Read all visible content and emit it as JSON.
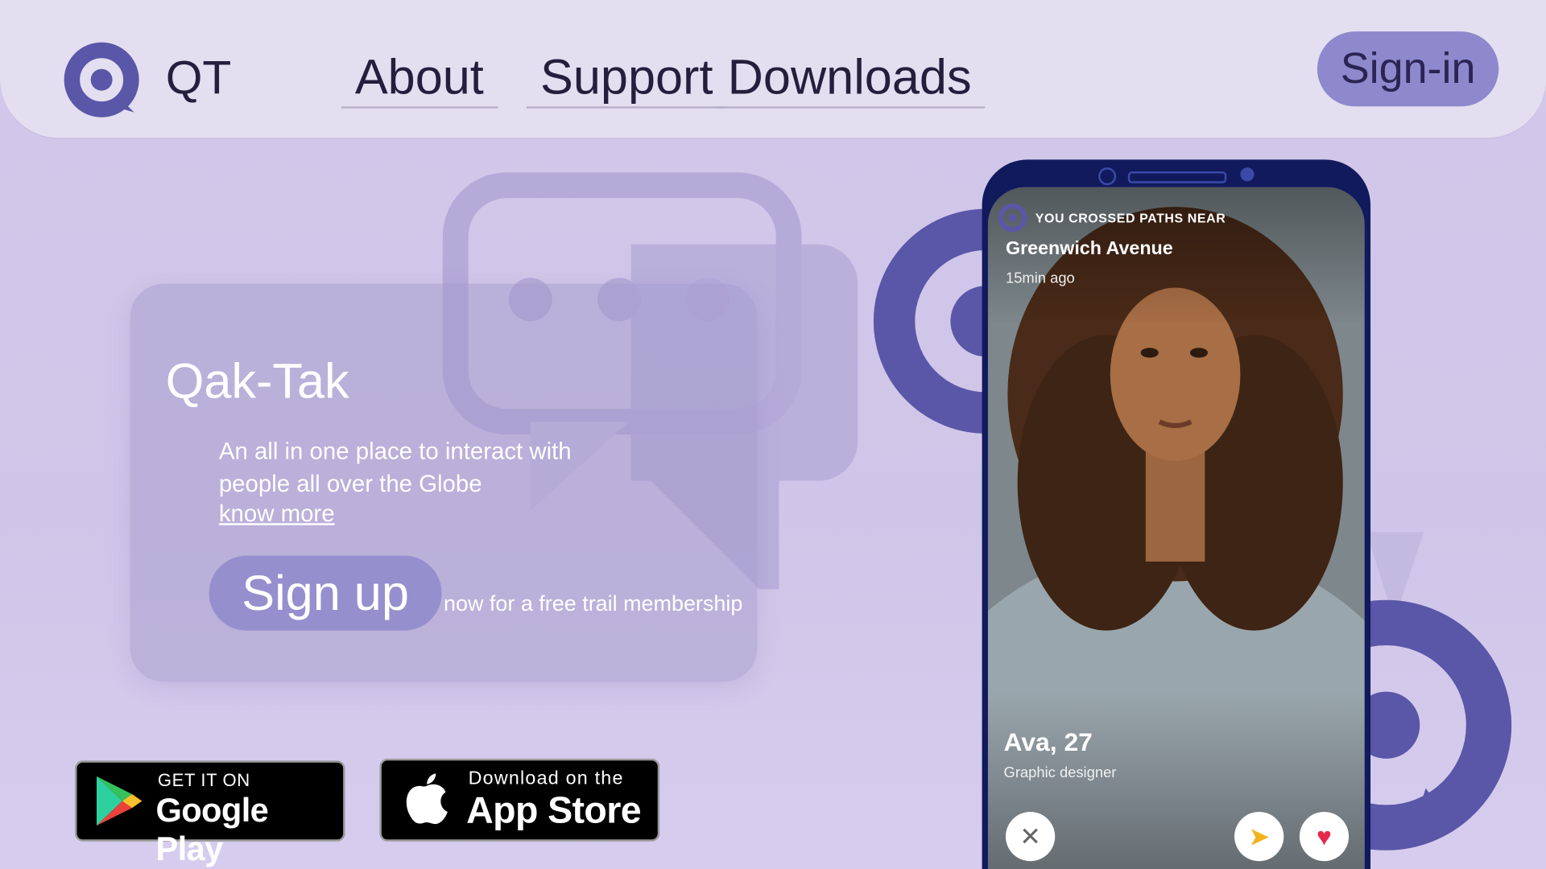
{
  "header": {
    "brand": "QT",
    "nav": {
      "about": "About",
      "support": "Support",
      "downloads": "Downloads"
    },
    "signin_label": "Sign-in"
  },
  "hero": {
    "title": "Qak-Tak",
    "description": "An all in one place to interact with people all over the Globe",
    "know_more": "know more",
    "signup_label": "Sign up",
    "signup_note": "now for a free trail membership"
  },
  "badges": {
    "google": {
      "small": "GET IT ON",
      "big": "Google Play"
    },
    "apple": {
      "small": "Download on the",
      "big": "App Store"
    }
  },
  "phone": {
    "crossed_paths": "YOU CROSSED PATHS NEAR",
    "place": "Greenwich Avenue",
    "time_ago": "15min ago",
    "profile_name": "Ava, 27",
    "profile_job": "Graphic designer",
    "actions": {
      "close": "✕",
      "send": "➤",
      "like": "♥"
    }
  },
  "colors": {
    "accent": "#5a57a8",
    "button": "#8e88cd",
    "background": "#d2c8ea"
  }
}
